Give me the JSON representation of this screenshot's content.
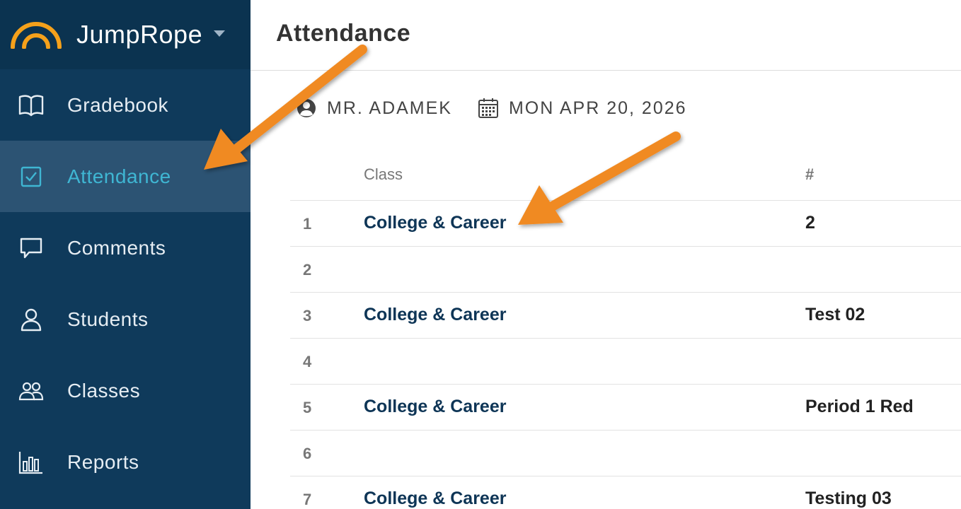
{
  "app": {
    "name": "JumpRope",
    "logo_color": "#f5a11b"
  },
  "sidebar": {
    "background": "#0f3a5b",
    "active_color": "#3fb6d3",
    "items": [
      {
        "label": "Gradebook",
        "icon": "book-icon",
        "active": false
      },
      {
        "label": "Attendance",
        "icon": "checkbox-icon",
        "active": true
      },
      {
        "label": "Comments",
        "icon": "speech-bubble-icon",
        "active": false
      },
      {
        "label": "Students",
        "icon": "person-icon",
        "active": false
      },
      {
        "label": "Classes",
        "icon": "group-icon",
        "active": false
      },
      {
        "label": "Reports",
        "icon": "bar-chart-icon",
        "active": false
      }
    ]
  },
  "header": {
    "title": "Attendance"
  },
  "meta": {
    "teacher": "MR. ADAMEK",
    "date": "MON APR 20, 2026"
  },
  "table": {
    "headers": {
      "class": "Class",
      "num": "#"
    },
    "rows": [
      {
        "index": "1",
        "class": "College & Career",
        "num": "2"
      },
      {
        "index": "2",
        "class": "",
        "num": ""
      },
      {
        "index": "3",
        "class": "College & Career",
        "num": "Test 02"
      },
      {
        "index": "4",
        "class": "",
        "num": ""
      },
      {
        "index": "5",
        "class": "College & Career",
        "num": "Period 1 Red"
      },
      {
        "index": "6",
        "class": "",
        "num": ""
      },
      {
        "index": "7",
        "class": "College & Career",
        "num": "Testing 03"
      }
    ]
  },
  "annotations": {
    "arrow_color": "#f08a24"
  }
}
